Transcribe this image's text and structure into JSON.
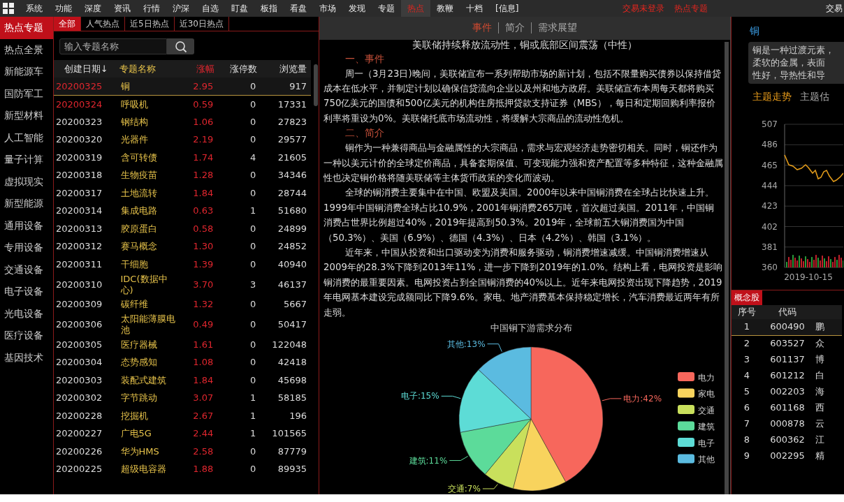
{
  "menu": {
    "items": [
      {
        "label": "系统",
        "selected": false
      },
      {
        "label": "功能",
        "selected": false
      },
      {
        "label": "深度",
        "selected": false
      },
      {
        "label": "资讯",
        "selected": false
      },
      {
        "label": "行情",
        "selected": false
      },
      {
        "label": "沪深",
        "selected": false
      },
      {
        "label": "自选",
        "selected": false
      },
      {
        "label": "盯盘",
        "selected": false
      },
      {
        "label": "板指",
        "selected": false
      },
      {
        "label": "看盘",
        "selected": false
      },
      {
        "label": "市场",
        "selected": false
      },
      {
        "label": "发现",
        "selected": false
      },
      {
        "label": "专题",
        "selected": false
      },
      {
        "label": "热点",
        "selected": true
      },
      {
        "label": "教鞭",
        "selected": false
      },
      {
        "label": "十档",
        "selected": false
      },
      {
        "label": "[信息]",
        "selected": false
      }
    ],
    "alerts": [
      "交易未登录",
      "热点专题"
    ],
    "right_text": "交易"
  },
  "sidebar": {
    "items": [
      {
        "label": "热点专题",
        "selected": true
      },
      {
        "label": "热点全景",
        "selected": false
      },
      {
        "label": "新能源车",
        "selected": false
      },
      {
        "label": "国防军工",
        "selected": false
      },
      {
        "label": "新型材料",
        "selected": false
      },
      {
        "label": "人工智能",
        "selected": false
      },
      {
        "label": "量子计算",
        "selected": false
      },
      {
        "label": "虚拟现实",
        "selected": false
      },
      {
        "label": "新型能源",
        "selected": false
      },
      {
        "label": "通用设备",
        "selected": false
      },
      {
        "label": "专用设备",
        "selected": false
      },
      {
        "label": "交通设备",
        "selected": false
      },
      {
        "label": "电子设备",
        "selected": false
      },
      {
        "label": "光电设备",
        "selected": false
      },
      {
        "label": "医疗设备",
        "selected": false
      },
      {
        "label": "基因技术",
        "selected": false
      }
    ]
  },
  "topic_list": {
    "tabs": [
      {
        "label": "全部",
        "selected": true
      },
      {
        "label": "人气热点",
        "selected": false
      },
      {
        "label": "近5日热点",
        "selected": false
      },
      {
        "label": "近30日热点",
        "selected": false
      }
    ],
    "search": {
      "placeholder": "输入专题名称"
    },
    "columns": [
      "创建日期↓",
      "专题名称",
      "涨幅",
      "涨停数",
      "浏览量"
    ],
    "rows": [
      {
        "date": "20200325",
        "name": "铜",
        "change": "2.95",
        "limit_up": "0",
        "views": "917",
        "new": true,
        "selected": true
      },
      {
        "date": "20200324",
        "name": "呼吸机",
        "change": "0.59",
        "limit_up": "0",
        "views": "17331",
        "new": true,
        "selected": false
      },
      {
        "date": "20200323",
        "name": "钢结构",
        "change": "1.06",
        "limit_up": "0",
        "views": "27823",
        "new": false,
        "selected": false
      },
      {
        "date": "20200320",
        "name": "光器件",
        "change": "2.19",
        "limit_up": "0",
        "views": "29577",
        "new": false,
        "selected": false
      },
      {
        "date": "20200319",
        "name": "含可转债",
        "change": "1.74",
        "limit_up": "4",
        "views": "21605",
        "new": false,
        "selected": false
      },
      {
        "date": "20200318",
        "name": "生物疫苗",
        "change": "1.28",
        "limit_up": "0",
        "views": "34346",
        "new": false,
        "selected": false
      },
      {
        "date": "20200317",
        "name": "土地流转",
        "change": "1.84",
        "limit_up": "0",
        "views": "28744",
        "new": false,
        "selected": false
      },
      {
        "date": "20200314",
        "name": "集成电路",
        "change": "0.63",
        "limit_up": "1",
        "views": "51680",
        "new": false,
        "selected": false
      },
      {
        "date": "20200313",
        "name": "胶原蛋白",
        "change": "0.58",
        "limit_up": "0",
        "views": "24899",
        "new": false,
        "selected": false
      },
      {
        "date": "20200312",
        "name": "赛马概念",
        "change": "1.30",
        "limit_up": "0",
        "views": "24852",
        "new": false,
        "selected": false
      },
      {
        "date": "20200311",
        "name": "干细胞",
        "change": "1.39",
        "limit_up": "0",
        "views": "40940",
        "new": false,
        "selected": false
      },
      {
        "date": "20200310",
        "name": "IDC(数据中心)",
        "change": "3.70",
        "limit_up": "3",
        "views": "46137",
        "new": false,
        "selected": false
      },
      {
        "date": "20200309",
        "name": "碳纤维",
        "change": "1.32",
        "limit_up": "0",
        "views": "5667",
        "new": false,
        "selected": false
      },
      {
        "date": "20200306",
        "name": "太阳能薄膜电池",
        "change": "0.49",
        "limit_up": "0",
        "views": "50417",
        "new": false,
        "selected": false
      },
      {
        "date": "20200305",
        "name": "医疗器械",
        "change": "1.61",
        "limit_up": "0",
        "views": "122048",
        "new": false,
        "selected": false
      },
      {
        "date": "20200304",
        "name": "态势感知",
        "change": "1.08",
        "limit_up": "0",
        "views": "42418",
        "new": false,
        "selected": false
      },
      {
        "date": "20200303",
        "name": "装配式建筑",
        "change": "1.84",
        "limit_up": "0",
        "views": "45698",
        "new": false,
        "selected": false
      },
      {
        "date": "20200302",
        "name": "字节跳动",
        "change": "3.07",
        "limit_up": "1",
        "views": "58185",
        "new": false,
        "selected": false
      },
      {
        "date": "20200228",
        "name": "挖掘机",
        "change": "2.67",
        "limit_up": "1",
        "views": "196",
        "new": false,
        "selected": false
      },
      {
        "date": "20200227",
        "name": "广电5G",
        "change": "2.44",
        "limit_up": "1",
        "views": "101565",
        "new": false,
        "selected": false
      },
      {
        "date": "20200226",
        "name": "华为HMS",
        "change": "2.58",
        "limit_up": "0",
        "views": "87779",
        "new": false,
        "selected": false
      },
      {
        "date": "20200225",
        "name": "超级电容器",
        "change": "1.88",
        "limit_up": "0",
        "views": "89935",
        "new": false,
        "selected": false
      }
    ]
  },
  "article": {
    "tabs": [
      {
        "label": "事件",
        "selected": true
      },
      {
        "label": "简介",
        "selected": false
      },
      {
        "label": "需求展望",
        "selected": false
      }
    ],
    "title": "美联储持续释放流动性，铜或底部区间震荡（中性）",
    "blocks": [
      {
        "kind": "heading",
        "text": "一、事件"
      },
      {
        "kind": "paragraph",
        "text": "周一（3月23日)晚间，美联储宣布一系列帮助市场的新计划，包括不限量购买债券以保持借贷成本在低水平，并制定计划以确保信贷流向企业以及州和地方政府。美联储宣布本周每天都将购买750亿美元的国债和500亿美元的机构住房抵押贷款支持证券（MBS），每日和定期回购利率报价利率将重设为0%。美联储托底市场流动性，将缓解大宗商品的流动性危机。"
      },
      {
        "kind": "heading",
        "text": "二、简介"
      },
      {
        "kind": "paragraph",
        "text": "铜作为一种兼得商品与金融属性的大宗商品，需求与宏观经济走势密切相关。同时，铜还作为一种以美元计价的全球定价商品，具备套期保值、可变现能力强和资产配置等多种特征，这种金融属性也决定铜价格将随美联储等主体货币政策的变化而波动。"
      },
      {
        "kind": "paragraph",
        "text": "全球的铜消费主要集中在中国、欧盟及美国。2000年以来中国铜消费在全球占比快速上升。1999年中国铜消费全球占比10.9%，2001年铜消费265万吨，首次超过美国。2011年，中国铜消费占世界比例超过40%，2019年提高到50.3%。2019年，全球前五大铜消费国为中国（50.3%）、美国（6.9%）、德国（4.3%）、日本（4.2%）、韩国（3.1%）。"
      },
      {
        "kind": "paragraph",
        "text": "近年来，中国从投资和出口驱动变为消费和服务驱动，铜消费增速减缓。中国铜消费增速从2009年的28.3%下降到2013年11%，进一步下降到2019年的1.0%。结构上看，电网投资是影响铜消费的最重要因素。电网投资占到全国铜消费的40%以上。近年来电网投资出现下降趋势，2019年电网基本建设完成额同比下降9.6%。家电、地产消费基本保持稳定增长，汽车消费最近两年有所走弱。"
      }
    ],
    "chart_data": {
      "type": "pie",
      "title": "中国铜下游需求分布",
      "categories": [
        "电力",
        "家电",
        "交通",
        "建筑",
        "电子",
        "其他"
      ],
      "series": [
        {
          "values": [
            42,
            12,
            7,
            11,
            15,
            13
          ]
        }
      ],
      "legend": "right",
      "colors": [
        "#f7675c",
        "#f8d35d",
        "#c9e05c",
        "#5cdb9a",
        "#5ddcd6",
        "#5bbbe0"
      ],
      "annotations": [
        {
          "x": "电力",
          "text": "电力:42%"
        },
        {
          "x": "交通",
          "text": "交通:7%"
        },
        {
          "x": "建筑",
          "text": "建筑:11%"
        },
        {
          "x": "电子",
          "text": "电子:15%"
        },
        {
          "x": "其他",
          "text": "其他:13%"
        }
      ]
    }
  },
  "detail": {
    "title": "铜",
    "description_lines": [
      "铜是一种过渡元素，",
      "柔软的金属，表面",
      "性好，导热性和导"
    ],
    "tabs": [
      {
        "label": "主题走势",
        "selected": true
      },
      {
        "label": "主题估",
        "selected": false
      }
    ],
    "trend": {
      "y_labels": [
        "507",
        "486",
        "465",
        "444",
        "423",
        "402",
        "381",
        "360"
      ],
      "x_label": "2019-10-15"
    },
    "stocks": {
      "tab": "概念股",
      "columns": [
        "序号",
        "代码"
      ],
      "rows": [
        {
          "no": "1",
          "code": "600490",
          "name": "鹏",
          "selected": true
        },
        {
          "no": "2",
          "code": "603527",
          "name": "众",
          "selected": false
        },
        {
          "no": "3",
          "code": "601137",
          "name": "博",
          "selected": false
        },
        {
          "no": "4",
          "code": "601212",
          "name": "白",
          "selected": false
        },
        {
          "no": "5",
          "code": "002203",
          "name": "海",
          "selected": false
        },
        {
          "no": "6",
          "code": "601168",
          "name": "西",
          "selected": false
        },
        {
          "no": "7",
          "code": "000878",
          "name": "云",
          "selected": false
        },
        {
          "no": "8",
          "code": "600362",
          "name": "江",
          "selected": false
        },
        {
          "no": "9",
          "code": "002295",
          "name": "精",
          "selected": false
        }
      ]
    }
  }
}
